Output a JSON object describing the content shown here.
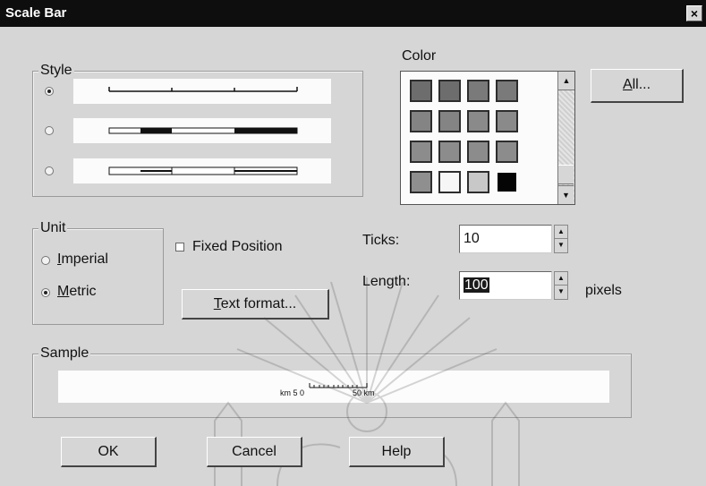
{
  "window": {
    "title": "Scale Bar",
    "close_glyph": "×"
  },
  "style_group": {
    "label": "Style",
    "selected_index": 0,
    "options": [
      "thin-line",
      "thick-alternating",
      "hollow-alternating"
    ]
  },
  "color_group": {
    "label": "Color",
    "swatches": [
      "#6d6d6d",
      "#6d6d6d",
      "#7a7a7a",
      "#7a7a7a",
      "#848484",
      "#848484",
      "#8a8a8a",
      "#8a8a8a",
      "#8c8c8c",
      "#8c8c8c",
      "#8c8c8c",
      "#8c8c8c",
      "#8f8f8f",
      "#f6f6f6",
      "#c8c8c8",
      "#050505"
    ],
    "selected_index": 15
  },
  "all_button": {
    "label_u": "A",
    "label_rest": "ll..."
  },
  "unit_group": {
    "label": "Unit",
    "imperial_u": "I",
    "imperial_rest": "mperial",
    "metric_u": "M",
    "metric_rest": "etric",
    "selected": "metric"
  },
  "fixed_position": {
    "label": "Fixed Position",
    "checked": false
  },
  "text_format_button": {
    "label_u": "T",
    "label_rest": "ext format..."
  },
  "ticks": {
    "label": "Ticks:",
    "value": "10"
  },
  "length": {
    "label": "Length:",
    "value": "100",
    "unit": "pixels"
  },
  "sample_group": {
    "label": "Sample",
    "left_text": "km 5 0",
    "right_text": "50 km"
  },
  "buttons": {
    "ok": "OK",
    "cancel": "Cancel",
    "help": "Help"
  }
}
